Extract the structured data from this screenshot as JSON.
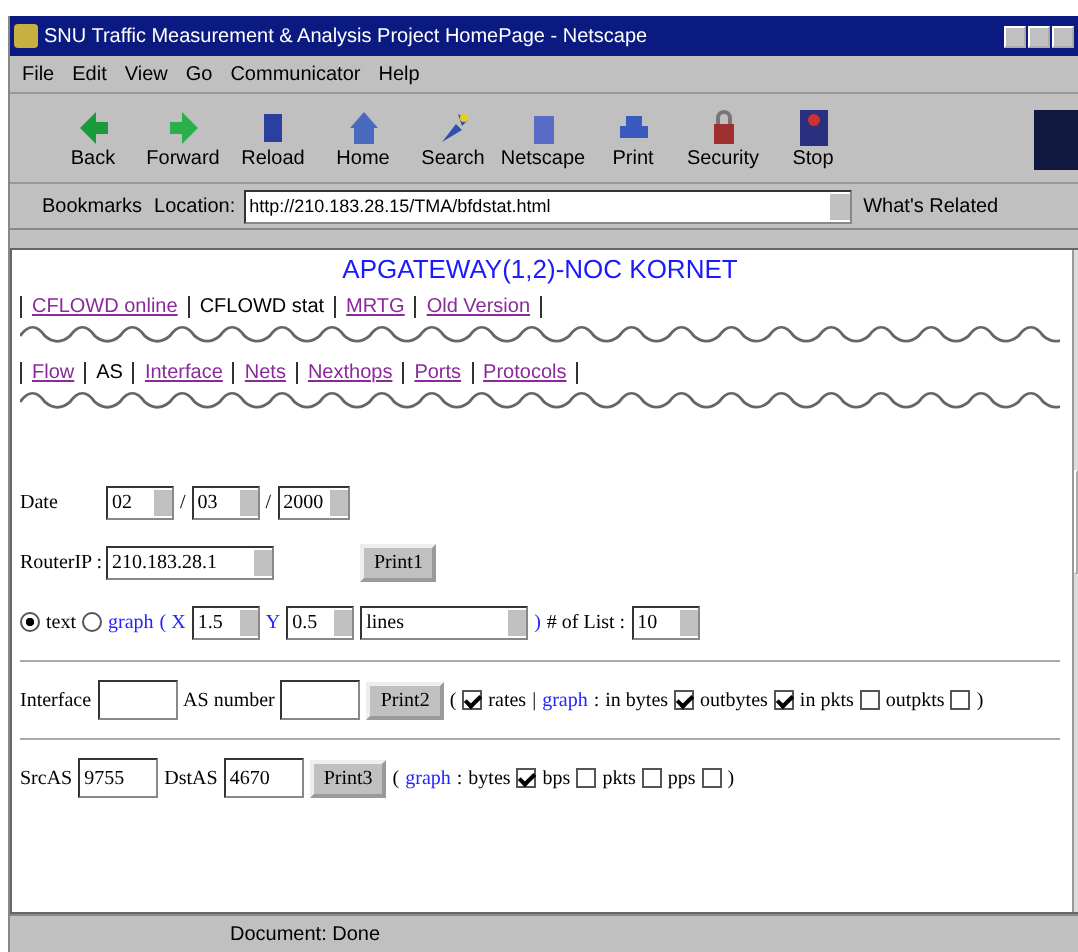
{
  "window": {
    "title": "SNU Traffic Measurement & Analysis Project HomePage - Netscape"
  },
  "menu": [
    "File",
    "Edit",
    "View",
    "Go",
    "Communicator",
    "Help"
  ],
  "toolbar": [
    "Back",
    "Forward",
    "Reload",
    "Home",
    "Search",
    "Netscape",
    "Print",
    "Security",
    "Stop"
  ],
  "location_bar": {
    "bookmarks": "Bookmarks",
    "location_label": "Location:",
    "url": "http://210.183.28.15/TMA/bfdstat.html",
    "related": "What's Related"
  },
  "page": {
    "heading": "APGATEWAY(1,2)-NOC KORNET",
    "nav_top": [
      {
        "label": "CFLOWD online",
        "selected": false
      },
      {
        "label": "CFLOWD stat",
        "selected": true
      },
      {
        "label": "MRTG",
        "selected": false
      },
      {
        "label": "Old Version",
        "selected": false
      }
    ],
    "nav_sub": [
      {
        "label": "Flow",
        "selected": false
      },
      {
        "label": "AS",
        "selected": true
      },
      {
        "label": "Interface",
        "selected": false
      },
      {
        "label": "Nets",
        "selected": false
      },
      {
        "label": "Nexthops",
        "selected": false
      },
      {
        "label": "Ports",
        "selected": false
      },
      {
        "label": "Protocols",
        "selected": false
      }
    ],
    "date": {
      "label": "Date",
      "separator": "/",
      "values": [
        "02",
        "03",
        "2000"
      ]
    },
    "router": {
      "label": "RouterIP :",
      "value": "210.183.28.1",
      "button": "Print1"
    },
    "mode": {
      "options": [
        {
          "label": "text",
          "selected": true
        },
        {
          "label": "graph",
          "selected": false
        }
      ],
      "x_label": "( X",
      "x_value": "1.5",
      "y_label": "Y",
      "y_value": "0.5",
      "style_value": "lines",
      "close": ")",
      "list_label": "# of List :",
      "list_value": "10"
    },
    "interface_row": {
      "interface_label": "Interface",
      "as_label": "AS number",
      "button": "Print2",
      "open": "(",
      "rates": {
        "label": "rates",
        "checked": true
      },
      "sep": "|",
      "graph_link": "graph",
      "colon": ":",
      "options": [
        {
          "label": "in bytes",
          "checked": true
        },
        {
          "label": "outbytes",
          "checked": true
        },
        {
          "label": "in pkts",
          "checked": false
        },
        {
          "label": "outpkts",
          "checked": false
        }
      ],
      "close": ")"
    },
    "as_row": {
      "src_label": "SrcAS",
      "src_value": "9755",
      "dst_label": "DstAS",
      "dst_value": "4670",
      "button": "Print3",
      "open": "(",
      "graph_link": "graph",
      "colon": ":",
      "options": [
        {
          "label": "bytes",
          "checked": true
        },
        {
          "label": "bps",
          "checked": false
        },
        {
          "label": "pkts",
          "checked": false
        },
        {
          "label": "pps",
          "checked": false
        }
      ],
      "close": ")"
    }
  },
  "status_bar": {
    "text": "Document: Done"
  }
}
